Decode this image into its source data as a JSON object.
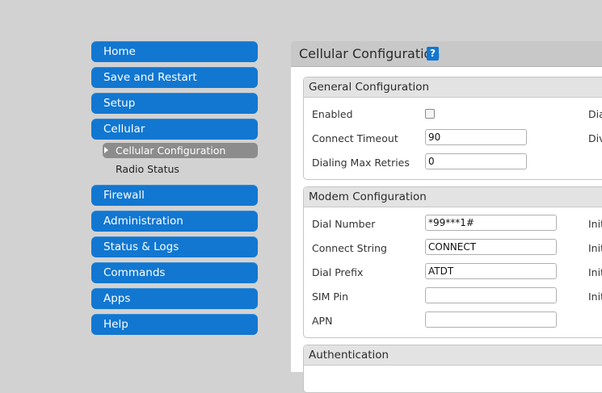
{
  "sidebar": {
    "items": [
      {
        "label": "Home"
      },
      {
        "label": "Save and Restart"
      },
      {
        "label": "Setup"
      },
      {
        "label": "Cellular"
      },
      {
        "label": "Firewall"
      },
      {
        "label": "Administration"
      },
      {
        "label": "Status & Logs"
      },
      {
        "label": "Commands"
      },
      {
        "label": "Apps"
      },
      {
        "label": "Help"
      }
    ],
    "cellular_sub": [
      {
        "label": "Cellular Configuration",
        "active": true
      },
      {
        "label": "Radio Status",
        "active": false
      }
    ]
  },
  "main": {
    "title": "Cellular Configuration",
    "help_label": "?",
    "general": {
      "title": "General Configuration",
      "enabled_label": "Enabled",
      "enabled": false,
      "connect_timeout_label": "Connect Timeout",
      "connect_timeout_value": "90",
      "dialing_max_retries_label": "Dialing Max Retries",
      "dialing_max_retries_value": "0",
      "right_col_cut": [
        "Dia",
        "Div"
      ]
    },
    "modem": {
      "title": "Modem Configuration",
      "dial_number_label": "Dial Number",
      "dial_number_value": "*99***1#",
      "connect_string_label": "Connect String",
      "connect_string_value": "CONNECT",
      "dial_prefix_label": "Dial Prefix",
      "dial_prefix_value": "ATDT",
      "sim_pin_label": "SIM Pin",
      "sim_pin_value": "",
      "apn_label": "APN",
      "apn_value": "",
      "right_col_cut": [
        "Init",
        "Init",
        "Init",
        "Init"
      ]
    },
    "authentication": {
      "title": "Authentication"
    }
  }
}
